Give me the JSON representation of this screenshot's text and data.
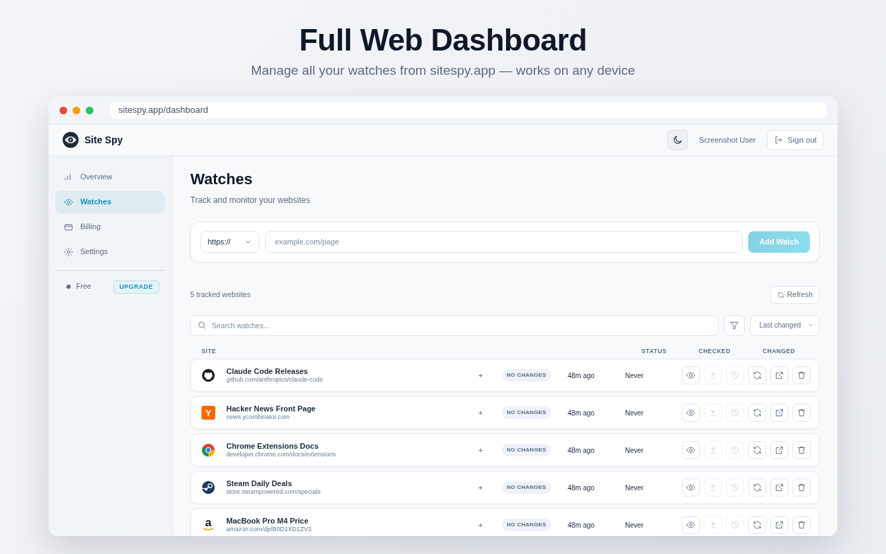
{
  "hero": {
    "title": "Full Web Dashboard",
    "subtitle": "Manage all your watches from sitespy.app — works on any device"
  },
  "browser": {
    "url": "sitespy.app/dashboard"
  },
  "app_header": {
    "brand": "Site Spy",
    "user": "Screenshot User",
    "sign_out": "Sign out"
  },
  "sidebar": {
    "items": [
      {
        "label": "Overview",
        "selected": false
      },
      {
        "label": "Watches",
        "selected": true
      },
      {
        "label": "Billing",
        "selected": false
      },
      {
        "label": "Settings",
        "selected": false
      }
    ],
    "plan": "Free",
    "upgrade": "UPGRADE"
  },
  "page": {
    "title": "Watches",
    "subtitle": "Track and monitor your websites"
  },
  "add_form": {
    "protocol": "https://",
    "placeholder": "example.com/page",
    "button": "Add Watch",
    "button_disabled": true
  },
  "list_header": {
    "count": "5 tracked websites",
    "refresh": "Refresh",
    "search_placeholder": "Search watches...",
    "sort": "Last changed"
  },
  "table": {
    "columns": [
      "SITE",
      "STATUS",
      "CHECKED",
      "CHANGED"
    ],
    "row_actions": [
      {
        "kind": "view",
        "disabled": false
      },
      {
        "kind": "diff",
        "disabled": true
      },
      {
        "kind": "history",
        "disabled": true
      },
      {
        "kind": "recheck",
        "disabled": false
      },
      {
        "kind": "open",
        "disabled": false
      },
      {
        "kind": "delete",
        "disabled": false
      }
    ],
    "rows": [
      {
        "kind": "github",
        "name": "Claude Code Releases",
        "url": "github.com/anthropics/claude-code",
        "expand": "+",
        "status": "NO CHANGES",
        "checked": "48m ago",
        "changed": "Never"
      },
      {
        "kind": "letter",
        "logo_letter": "Y",
        "name": "Hacker News Front Page",
        "url": "news.ycombinator.com",
        "expand": "+",
        "status": "NO CHANGES",
        "checked": "48m ago",
        "changed": "Never"
      },
      {
        "kind": "chrome",
        "name": "Chrome Extensions Docs",
        "url": "developer.chrome.com/docs/extensions",
        "expand": "+",
        "status": "NO CHANGES",
        "checked": "48m ago",
        "changed": "Never"
      },
      {
        "kind": "steam",
        "name": "Steam Daily Deals",
        "url": "store.steampowered.com/specials",
        "expand": "+",
        "status": "NO CHANGES",
        "checked": "48m ago",
        "changed": "Never"
      },
      {
        "kind": "amazon",
        "logo_letter": "a",
        "name": "MacBook Pro M4 Price",
        "url": "amazon.com/dp/B0D1XD1ZV3",
        "expand": "+",
        "status": "NO CHANGES",
        "checked": "48m ago",
        "changed": "Never"
      }
    ]
  }
}
